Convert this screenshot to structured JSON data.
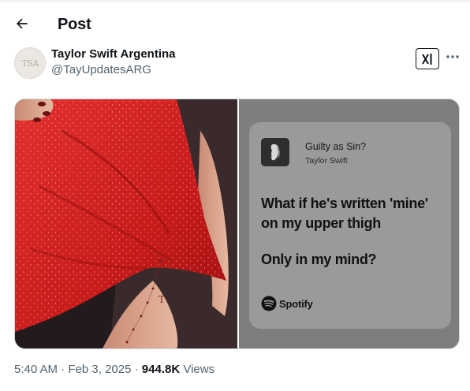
{
  "header": {
    "title": "Post",
    "back_icon": "arrow-left-icon"
  },
  "author": {
    "name": "Taylor Swift Argentina",
    "handle": "@TayUpdatesARG",
    "avatar_text": "TSA"
  },
  "actions": {
    "grok_icon": "grok-icon",
    "more_icon": "more-horizontal-icon"
  },
  "media": {
    "photo_alt": "Photo of leg tattoo with red dress",
    "tattoo_letter": "T",
    "spotify_card": {
      "song_title": "Guilty as Sin?",
      "artist": "Taylor Swift",
      "lyric_line_1": "What if he's written 'mine' on my upper thigh",
      "lyric_line_2": "Only in my mind?",
      "brand": "Spotify"
    }
  },
  "meta": {
    "time": "5:40 AM",
    "separator": "·",
    "date": "Feb 3, 2025",
    "views_count": "944.8K",
    "views_label": "Views"
  },
  "colors": {
    "text_primary": "#0f1419",
    "text_secondary": "#536471",
    "dress_red": "#d61f1f",
    "card_gray": "#9a9a9a",
    "panel_gray": "#7e7e7e"
  }
}
